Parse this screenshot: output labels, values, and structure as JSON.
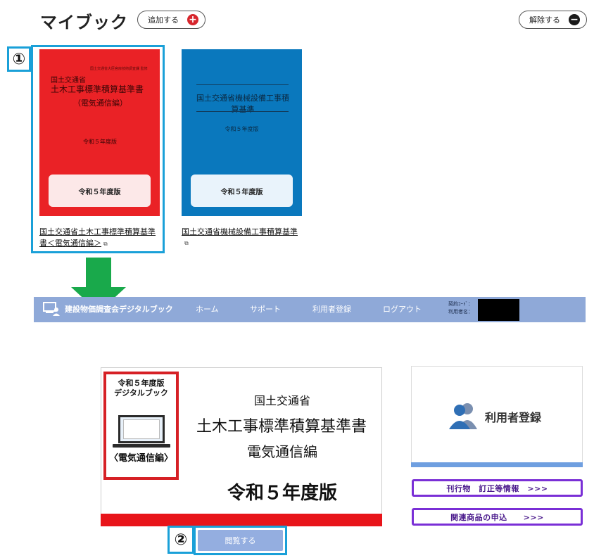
{
  "mybook": {
    "title": "マイブック",
    "add_label": "追加する",
    "add_symbol": "+",
    "remove_label": "解除する",
    "remove_symbol": "−"
  },
  "steps": {
    "step1": "①",
    "step2": "②"
  },
  "books": [
    {
      "cover_color": "#ea2226",
      "cover_small": "国土交通省大臣官房技術調査課 監修",
      "cover_line1": "国土交通省",
      "cover_line2": "土木工事標準積算基準書",
      "cover_line3": "（電気通信編）",
      "cover_line4": "令和５年度版",
      "edition_label": "令和５年度版",
      "link_text": "国土交通省土木工事標準積算基準書＜電気通信編＞",
      "ext_icon": "⧉"
    },
    {
      "cover_color": "#0a78bd",
      "cover_title": "国土交通省機械設備工事積算基準",
      "cover_year": "令和５年度版",
      "edition_label": "令和５年度版",
      "link_text": "国土交通省機械設備工事積算基準",
      "ext_icon": "⧉"
    }
  ],
  "navbar": {
    "brand": "建設物価調査会デジタルブック",
    "items": [
      "ホーム",
      "サポート",
      "利用者登録",
      "ログアウト"
    ],
    "meta_contract": "契約ｺｰﾄﾞ：",
    "meta_user": "利用者名："
  },
  "product": {
    "mini_title_1": "令和５年度版",
    "mini_title_2": "デジタルブック",
    "mini_subtitle": "〈電気通信編〉",
    "line1": "国土交通省",
    "line2": "土木工事標準積算基準書",
    "line3": "電気通信編",
    "line4": "令和５年度版"
  },
  "right_panel": {
    "register_label": "利用者登録",
    "btn_corrections": "刊行物　訂正等情報　>>>",
    "btn_related": "関連商品の申込　　>>>"
  },
  "view_button": {
    "label": "閲覧する"
  },
  "colors": {
    "accent_cyan": "#1aa0d8",
    "arrow_green": "#19a94b",
    "navbar_blue": "#8fa9d8",
    "purple": "#7a2fd6",
    "red": "#e8141a"
  }
}
